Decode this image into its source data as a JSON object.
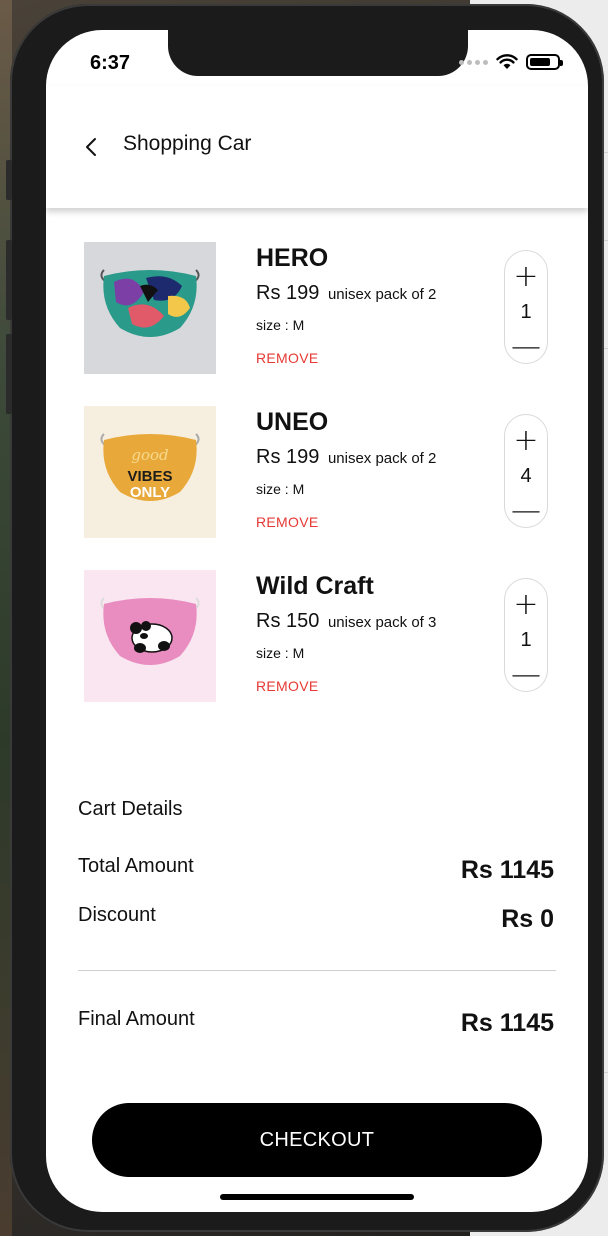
{
  "status": {
    "time": "6:37"
  },
  "header": {
    "title": "Shopping Car"
  },
  "items": [
    {
      "name": "HERO",
      "price": "Rs 199",
      "pack": "unisex pack of 2",
      "size": "size : M",
      "remove": "REMOVE",
      "qty": "1",
      "plus": "+",
      "minus": "—",
      "thumb_bg": "#d6d8dc"
    },
    {
      "name": "UNEO",
      "price": "Rs 199",
      "pack": "unisex pack of 2",
      "size": "size : M",
      "remove": "REMOVE",
      "qty": "4",
      "plus": "+",
      "minus": "—",
      "thumb_bg": "#f6efe0",
      "mask_text_1": "good",
      "mask_text_2": "VIBES",
      "mask_text_3": "ONLY"
    },
    {
      "name": "Wild Craft",
      "price": "Rs 150",
      "pack": "unisex pack of 3",
      "size": "size : M",
      "remove": "REMOVE",
      "qty": "1",
      "plus": "+",
      "minus": "—",
      "thumb_bg": "#fae6f0"
    }
  ],
  "cart_details": {
    "title": "Cart Details",
    "total_label": "Total Amount",
    "total_value": "Rs 1145",
    "discount_label": "Discount",
    "discount_value": "Rs 0",
    "final_label": "Final Amount",
    "final_value": "Rs 1145"
  },
  "checkout": {
    "label": "CHECKOUT"
  },
  "colors": {
    "remove": "#e53935",
    "button": "#000000",
    "accent_text": "#111111"
  },
  "icons": {
    "back": "chevron-left-icon",
    "wifi": "wifi-icon",
    "battery": "battery-icon",
    "signal": "cellular-signal-icon"
  },
  "battery_level": 0.75
}
